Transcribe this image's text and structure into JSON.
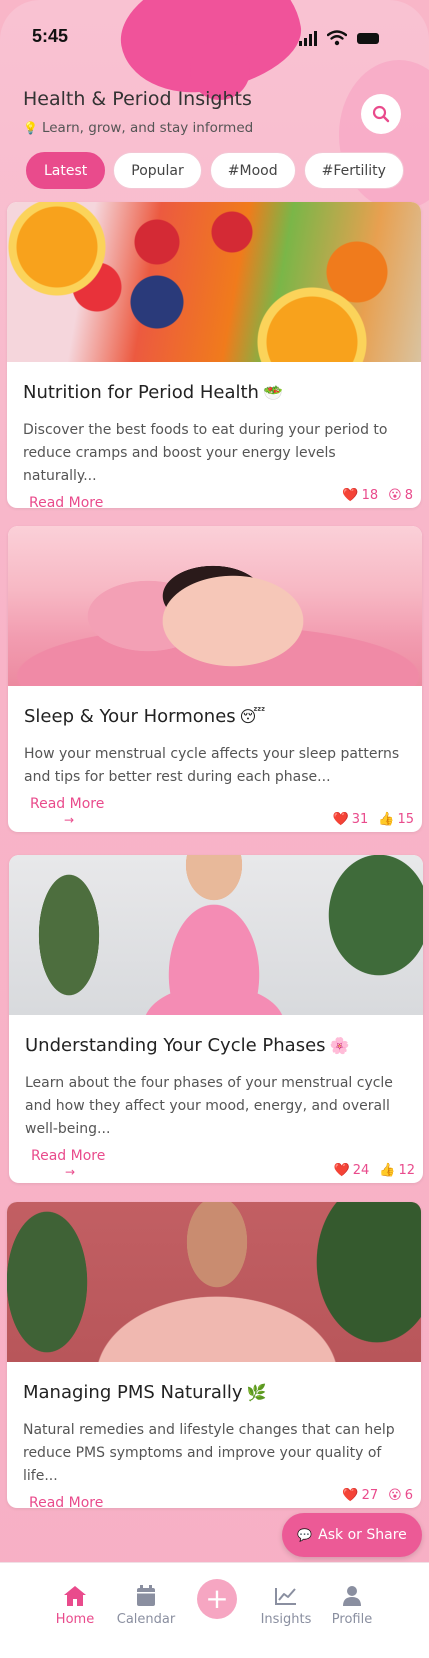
{
  "status_bar": {
    "time": "5:45"
  },
  "header": {
    "title": "Health & Period Insights",
    "subtitle": "Learn, grow, and stay informed",
    "subtitle_icon": "lightbulb-icon"
  },
  "filters": [
    {
      "label": "Latest",
      "active": true
    },
    {
      "label": "Popular",
      "active": false
    },
    {
      "label": "#Mood",
      "active": false
    },
    {
      "label": "#Fertility",
      "active": false
    }
  ],
  "articles": [
    {
      "title": "Nutrition for Period Health",
      "emoji": "🥗",
      "description": "Discover the best foods to eat during your period to reduce cramps and boost your energy levels naturally...",
      "read_more": "Read More",
      "arrow": "→",
      "reactions": [
        {
          "icon": "❤️",
          "count": "18"
        },
        {
          "icon": "😮",
          "count": "8"
        }
      ]
    },
    {
      "title": "Sleep & Your Hormones",
      "emoji": "😴",
      "description": "How your menstrual cycle affects your sleep patterns and tips for better rest during each phase...",
      "read_more": "Read More",
      "arrow": "→",
      "reactions": [
        {
          "icon": "❤️",
          "count": "31"
        },
        {
          "icon": "👍",
          "count": "15"
        }
      ]
    },
    {
      "title": "Understanding Your Cycle Phases",
      "emoji": "🌸",
      "description": "Learn about the four phases of your menstrual cycle and how they affect your mood, energy, and overall well-being...",
      "read_more": "Read More",
      "arrow": "→",
      "reactions": [
        {
          "icon": "❤️",
          "count": "24"
        },
        {
          "icon": "👍",
          "count": "12"
        }
      ]
    },
    {
      "title": "Managing PMS Naturally",
      "emoji": "🌿",
      "description": "Natural remedies and lifestyle changes that can help reduce PMS symptoms and improve your quality of life...",
      "read_more": "Read More",
      "arrow": "→",
      "reactions": [
        {
          "icon": "❤️",
          "count": "27"
        },
        {
          "icon": "😮",
          "count": "6"
        }
      ]
    }
  ],
  "ask_button": {
    "label": "Ask or Share",
    "icon": "chat-bubble-icon"
  },
  "bottom_nav": [
    {
      "label": "Home",
      "icon": "home-icon",
      "active": true
    },
    {
      "label": "Calendar",
      "icon": "calendar-icon",
      "active": false
    },
    {
      "label": "+",
      "icon": "plus-icon",
      "active": false
    },
    {
      "label": "Insights",
      "icon": "chart-icon",
      "active": false
    },
    {
      "label": "Profile",
      "icon": "person-icon",
      "active": false
    }
  ],
  "colors": {
    "accent": "#e94b8c",
    "background": "#f8b4c8",
    "blob": "#f0539a"
  }
}
